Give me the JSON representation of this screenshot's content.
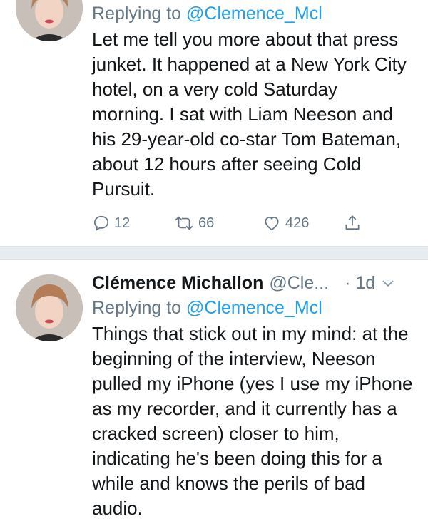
{
  "tweet1": {
    "replying_prefix": "Replying to ",
    "replying_to": "@Clemence_Mcl",
    "text": "Let me tell you more about that press junket. It happened at a New York City hotel, on a very cold Saturday morning. I sat with Liam Neeson and his 29-year-old co-star Tom Bateman, about 12 hours after seeing Cold Pursuit.",
    "replies": "12",
    "retweets": "66",
    "likes": "426"
  },
  "tweet2": {
    "name": "Clémence Michallon",
    "handle": "@Cle...",
    "time": "· 1d",
    "replying_prefix": "Replying to ",
    "replying_to": "@Clemence_Mcl",
    "text": "Things that stick out in my mind: at the beginning of the interview, Neeson pulled my iPhone (yes I use my iPhone as my recorder, and it currently has a cracked screen) closer to him, indicating he's been doing this for a while and knows the perils of bad audio."
  },
  "icons": {
    "reply": "reply-icon",
    "retweet": "retweet-icon",
    "like": "heart-icon",
    "share": "share-icon",
    "caret": "chevron-down-icon"
  },
  "colors": {
    "link": "#1da1f2",
    "secondary": "#657786",
    "text": "#14171a",
    "divider": "#e6ecf0"
  }
}
